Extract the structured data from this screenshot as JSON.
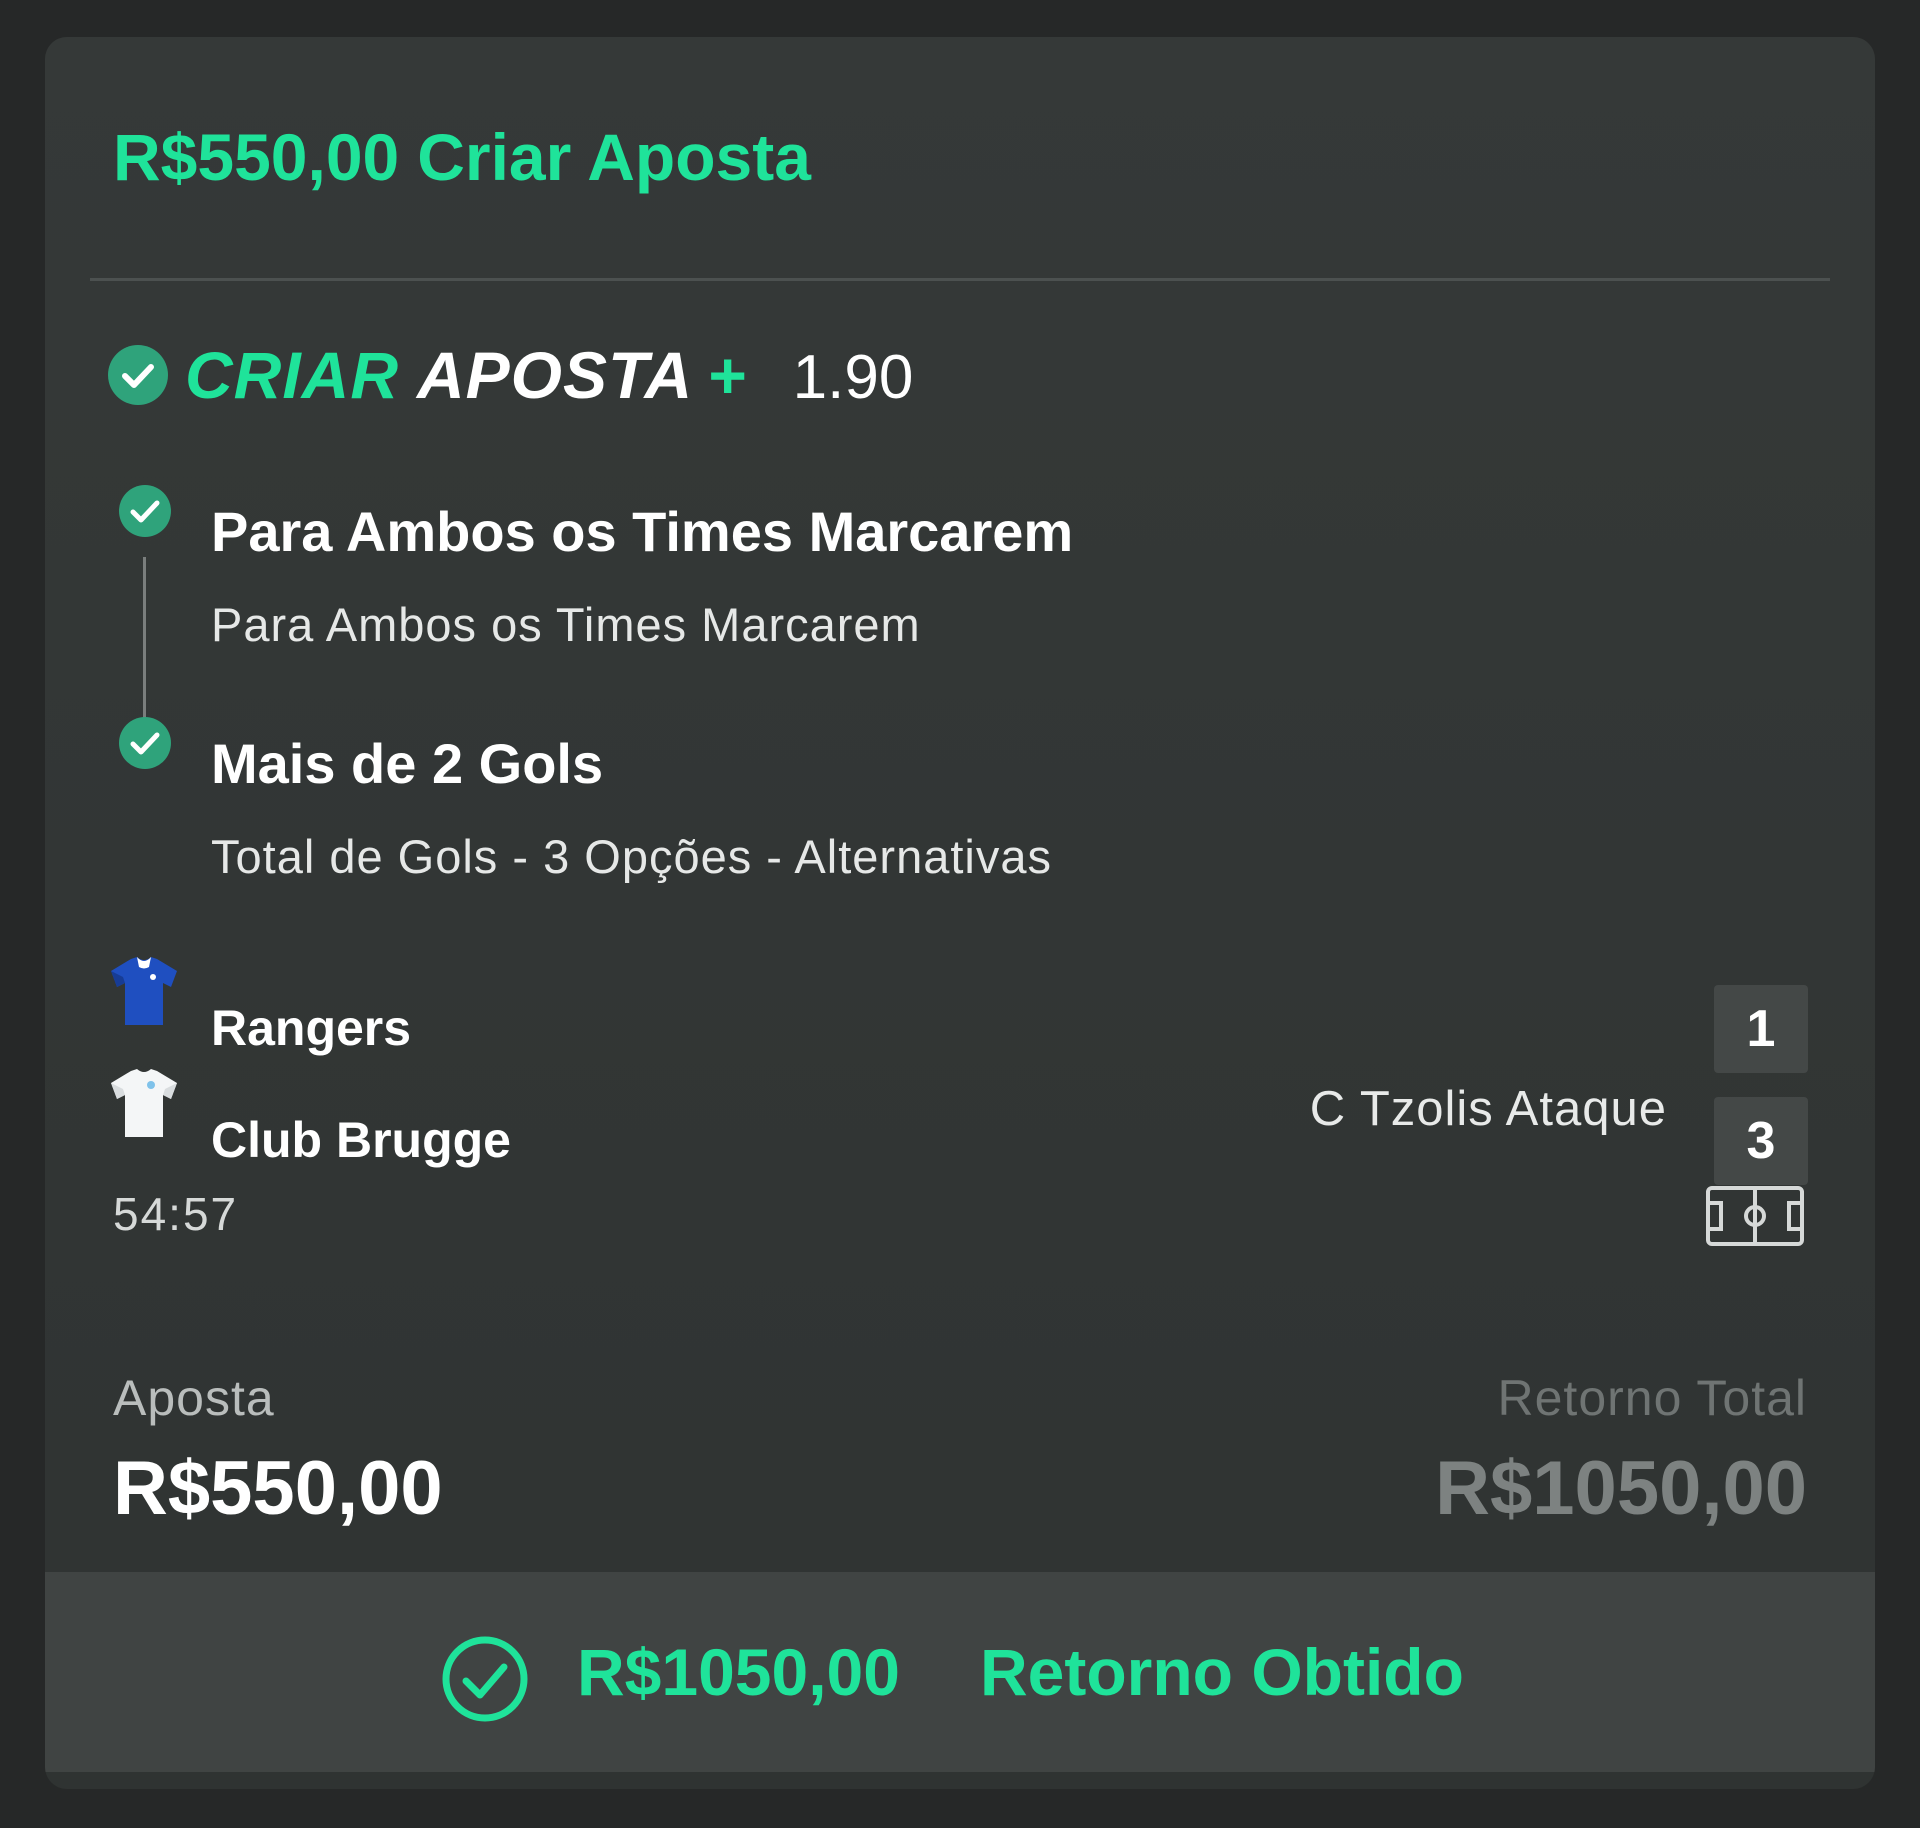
{
  "header": {
    "amount": "R$550,00",
    "title": "Criar Aposta"
  },
  "brand": {
    "part1": "CRIAR",
    "part2": "APOSTA",
    "plus": "+",
    "odds": "1.90"
  },
  "selections": [
    {
      "title": "Para Ambos os Times Marcarem",
      "market": "Para Ambos os Times Marcarem",
      "status_icon": "check-circle-icon"
    },
    {
      "title": "Mais de 2 Gols",
      "market": "Total de Gols - 3 Opções - Alternativas",
      "status_icon": "check-circle-icon"
    }
  ],
  "match": {
    "teams": [
      {
        "name": "Rangers",
        "score": "1",
        "scorer": "",
        "jersey_color": "#1f4fc0"
      },
      {
        "name": "Club Brugge",
        "score": "3",
        "scorer": "C Tzolis Ataque",
        "jersey_color": "#f4f6f7"
      }
    ],
    "time": "54:57",
    "pitch_icon": "football-pitch-icon"
  },
  "stake": {
    "label": "Aposta",
    "value": "R$550,00"
  },
  "total_return": {
    "label": "Retorno Total",
    "value": "R$1050,00"
  },
  "footer": {
    "amount": "R$1050,00",
    "label": "Retorno Obtido",
    "icon": "check-circle-outline-icon"
  },
  "colors": {
    "accent": "#1fe39a",
    "check_fill": "#2fa37b",
    "card_bg": "#333736",
    "page_bg": "#262828",
    "score_box": "#444847"
  }
}
